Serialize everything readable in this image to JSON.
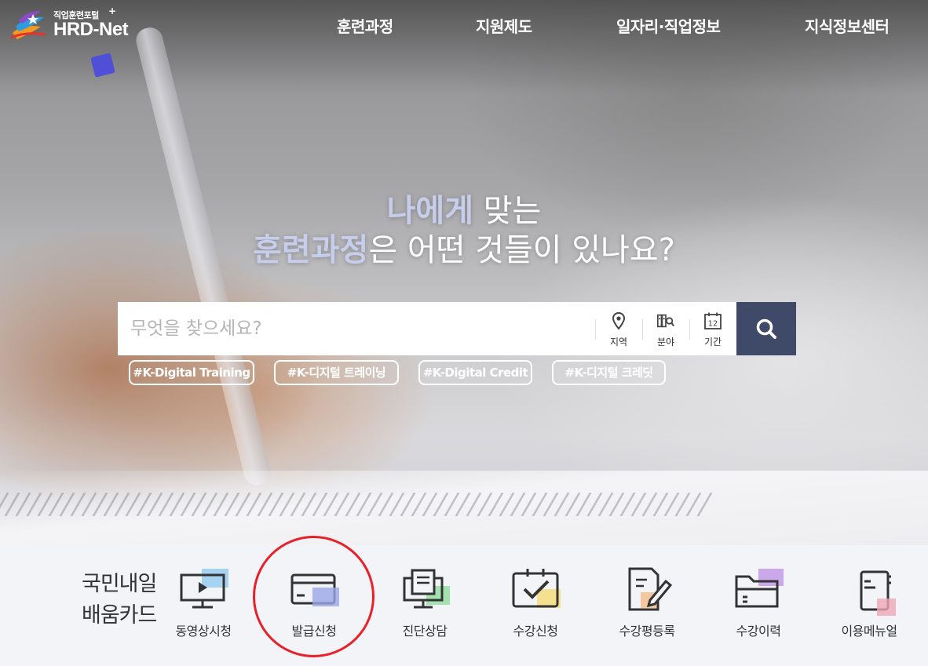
{
  "header": {
    "logo_sub": "직업훈련포털",
    "logo_plus": "+",
    "logo_main": "HRD-Net",
    "nav": [
      {
        "label": "훈련과정"
      },
      {
        "label": "지원제도"
      },
      {
        "label": "일자리·직업정보"
      },
      {
        "label": "지식정보센터"
      }
    ]
  },
  "hero": {
    "line1_strong": "나에게",
    "line1_rest": " 맞는",
    "line2_strong": "훈련과정",
    "line2_rest": "은 어떤 것들이 있나요?"
  },
  "search": {
    "placeholder": "무엇을 찾으세요?",
    "filters": [
      {
        "label": "지역",
        "icon": "location-pin-icon"
      },
      {
        "label": "분야",
        "icon": "field-books-icon"
      },
      {
        "label": "기간",
        "icon": "calendar-icon",
        "calendar_day": "12"
      }
    ],
    "button_icon": "search-icon"
  },
  "tags": [
    {
      "label": "#K-Digital Training"
    },
    {
      "label": "#K-디지털 트레이닝"
    },
    {
      "label": "#K-Digital Credit"
    },
    {
      "label": "#K-디지털 크레딧"
    }
  ],
  "card_section": {
    "title_line1": "국민내일",
    "title_line2": "배움카드",
    "items": [
      {
        "label": "동영상시청",
        "icon": "video-monitor-icon",
        "accent": "#8ec8f0"
      },
      {
        "label": "발급신청",
        "icon": "card-issue-icon",
        "accent": "#9aa6e6"
      },
      {
        "label": "진단상담",
        "icon": "document-consult-icon",
        "accent": "#8fdc9e"
      },
      {
        "label": "수강신청",
        "icon": "checkbox-apply-icon",
        "accent": "#f4dc7c"
      },
      {
        "label": "수강평등록",
        "icon": "review-pencil-icon",
        "accent": "#f2c08e"
      },
      {
        "label": "수강이력",
        "icon": "folder-history-icon",
        "accent": "#c39ae8"
      },
      {
        "label": "이용메뉴얼",
        "icon": "manual-book-icon",
        "accent": "#f0a6b6"
      }
    ]
  },
  "annotation": {
    "color": "#e8202a"
  }
}
